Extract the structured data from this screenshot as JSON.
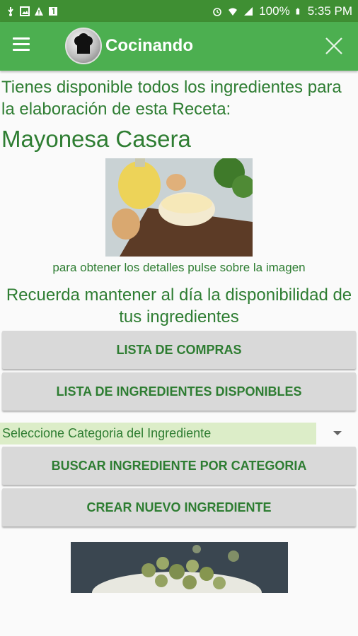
{
  "status_bar": {
    "battery": "100%",
    "time": "5:35 PM",
    "icons": [
      "usb-icon",
      "image-icon",
      "warning-icon",
      "notification-1-icon",
      "alarm-icon",
      "wifi-icon",
      "signal-icon",
      "battery-icon"
    ]
  },
  "app_bar": {
    "title": "Cocinando",
    "menu_icon": "menu-icon",
    "close_icon": "close-icon",
    "color": "#4caf50"
  },
  "main": {
    "intro": "Tienes disponible todos los ingredientes para la elaboración de esta Receta:",
    "recipe_title": "Mayonesa Casera",
    "image_hint": "para obtener los detalles pulse sobre la imagen",
    "reminder": "Recuerda mantener al día la disponibilidad de tus ingredientes",
    "buttons": {
      "shopping_list": "LISTA DE COMPRAS",
      "available_ingredients": "LISTA DE INGREDIENTES DISPONIBLES",
      "search_by_category": "BUSCAR INGREDIENTE POR CATEGORIA",
      "create_ingredient": "CREAR NUEVO INGREDIENTE"
    },
    "category_select": {
      "selected": "Seleccione Categoria del Ingrediente"
    }
  },
  "colors": {
    "text_green": "#2e7d32",
    "status_bar": "#3f8f33",
    "button_bg": "#d9d9d9",
    "spinner_bg": "#dcedc8"
  }
}
